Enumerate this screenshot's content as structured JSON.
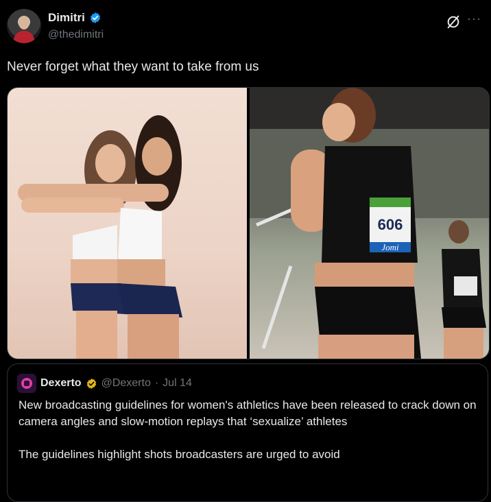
{
  "author": {
    "name": "Dimitri",
    "handle": "@thedimitri"
  },
  "header": {
    "more_label": "···"
  },
  "tweet": {
    "text": "Never forget what they want to take from us"
  },
  "media": {
    "images": [
      {
        "label": "photo-two-athletes"
      },
      {
        "label": "photo-runner-606"
      }
    ],
    "right_bib_number": "606",
    "right_bib_sponsor": "Jomi"
  },
  "quote": {
    "name": "Dexerto",
    "handle": "@Dexerto",
    "separator": "·",
    "date": "Jul 14",
    "paragraph1": "New broadcasting guidelines for women's athletics have been released to crack down on camera angles and slow-motion replays that ‘sexualize’ athletes",
    "paragraph2": "The guidelines highlight shots broadcasters are urged to avoid"
  },
  "colors": {
    "background": "#000000",
    "text": "#e7e9ea",
    "secondary": "#71767b",
    "verified_blue": "#1d9bf0",
    "verified_gold": "#e2b719",
    "border": "#2f3336"
  }
}
